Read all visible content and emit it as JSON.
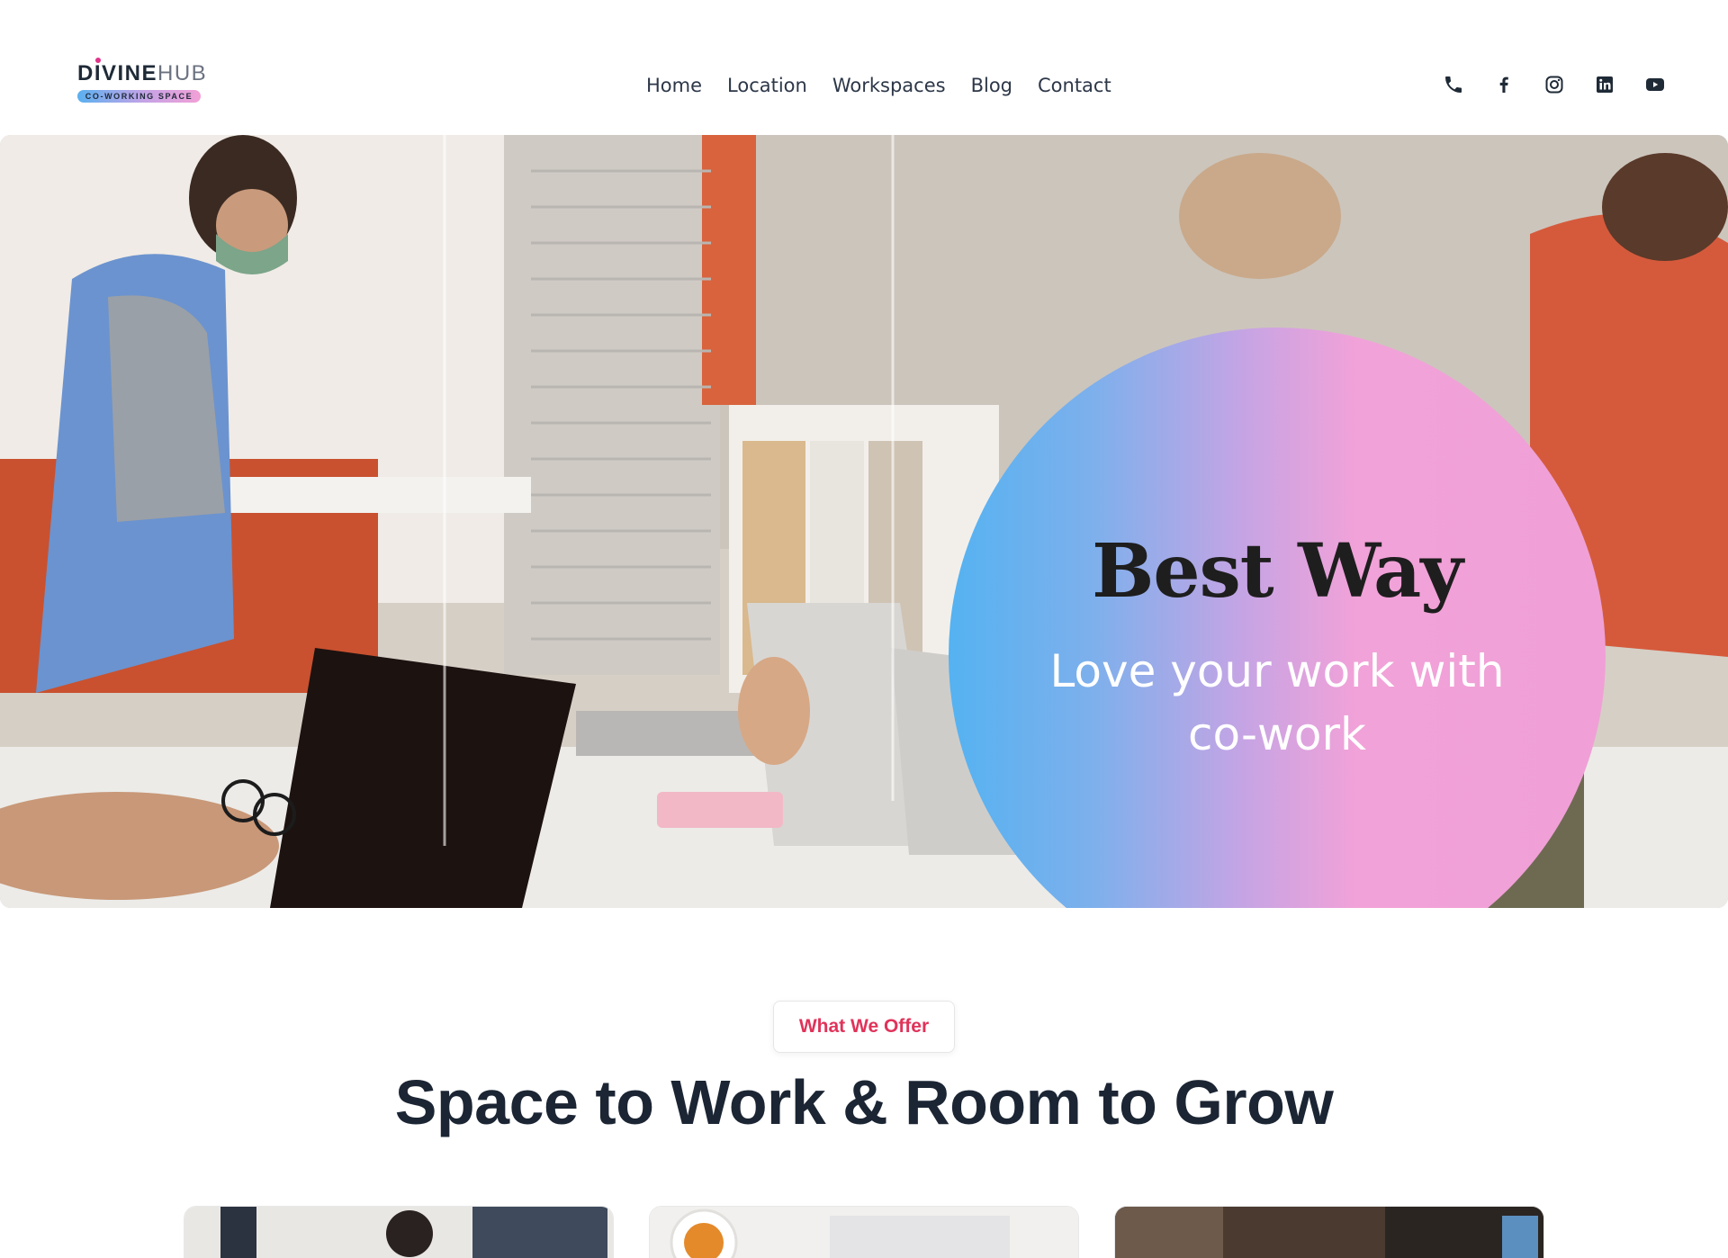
{
  "header": {
    "logo": {
      "brand_main": "DIVINE",
      "brand_suffix": "HUB",
      "tagline": "CO-WORKING SPACE"
    },
    "nav": [
      {
        "label": "Home"
      },
      {
        "label": "Location"
      },
      {
        "label": "Workspaces"
      },
      {
        "label": "Blog"
      },
      {
        "label": "Contact"
      }
    ],
    "social_icons": [
      "phone-icon",
      "facebook-icon",
      "instagram-icon",
      "linkedin-icon",
      "youtube-icon"
    ]
  },
  "hero": {
    "title": "Best Way",
    "subtitle": "Love your work with co-work",
    "gradient": [
      "#55b2f1",
      "#c6a4e4",
      "#f1a2d8"
    ]
  },
  "offer": {
    "badge": "What We Offer",
    "title": "Space to Work & Room to Grow",
    "badge_color": "#e0335a",
    "cards_count": 3
  }
}
